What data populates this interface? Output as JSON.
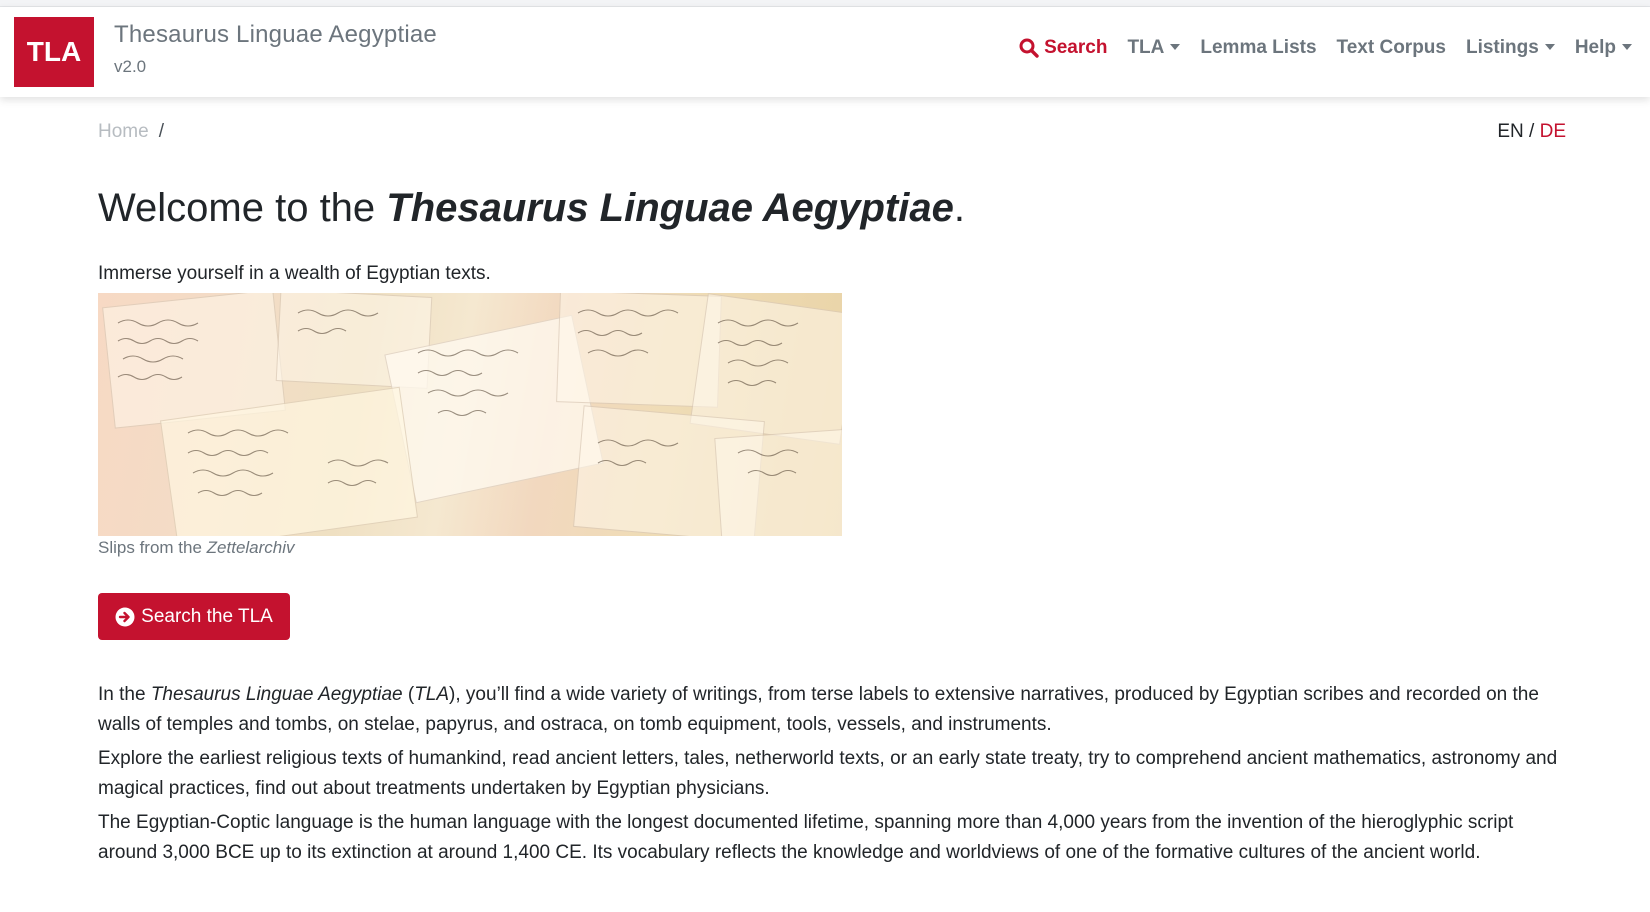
{
  "header": {
    "logo_text": "TLA",
    "title": "Thesaurus Linguae Aegyptiae",
    "version": "v2.0",
    "nav": {
      "search": "Search",
      "tla": "TLA",
      "lemma_lists": "Lemma Lists",
      "text_corpus": "Text Corpus",
      "listings": "Listings",
      "help": "Help"
    }
  },
  "breadcrumb": {
    "home": "Home",
    "separator": "/"
  },
  "language": {
    "en": "EN",
    "separator": "/",
    "de": "DE"
  },
  "main": {
    "heading_prefix": "Welcome to the ",
    "heading_italic": "Thesaurus Linguae Aegyptiae",
    "heading_suffix": ".",
    "lead": "Immerse yourself in a wealth of Egyptian texts.",
    "caption_prefix": "Slips from the ",
    "caption_italic": "Zettelarchiv",
    "cta_label": "Search the TLA",
    "p1_a": "In the ",
    "p1_b": "Thesaurus Linguae Aegyptiae",
    "p1_c": " (",
    "p1_d": "TLA",
    "p1_e": "), you’ll find a wide variety of writings, from terse labels to extensive narratives, produced by Egyptian scribes and recorded on the walls of temples and tombs, on stelae, papyrus, and ostraca, on tomb equipment, tools, vessels, and instruments.",
    "p2": "Explore the earliest religious texts of humankind, read ancient letters, tales, netherworld texts, or an early state treaty, try to comprehend ancient mathematics, astronomy and magical practices, find out about treatments undertaken by Egyptian physicians.",
    "p3": "The Egyptian-Coptic language is the human language with the longest documented lifetime, spanning more than 4,000 years from the invention of the hieroglyphic script around 3,000 BCE up to its extinction at around 1,400 CE. Its vocabulary reflects the knowledge and worldviews of one of the formative cultures of the ancient world."
  },
  "colors": {
    "brand": "#c4122f",
    "muted": "#6c757d",
    "text": "#212529"
  },
  "icons": {
    "search": "search-icon",
    "arrow": "arrow-circle-right-icon",
    "caret": "caret-down-icon"
  }
}
